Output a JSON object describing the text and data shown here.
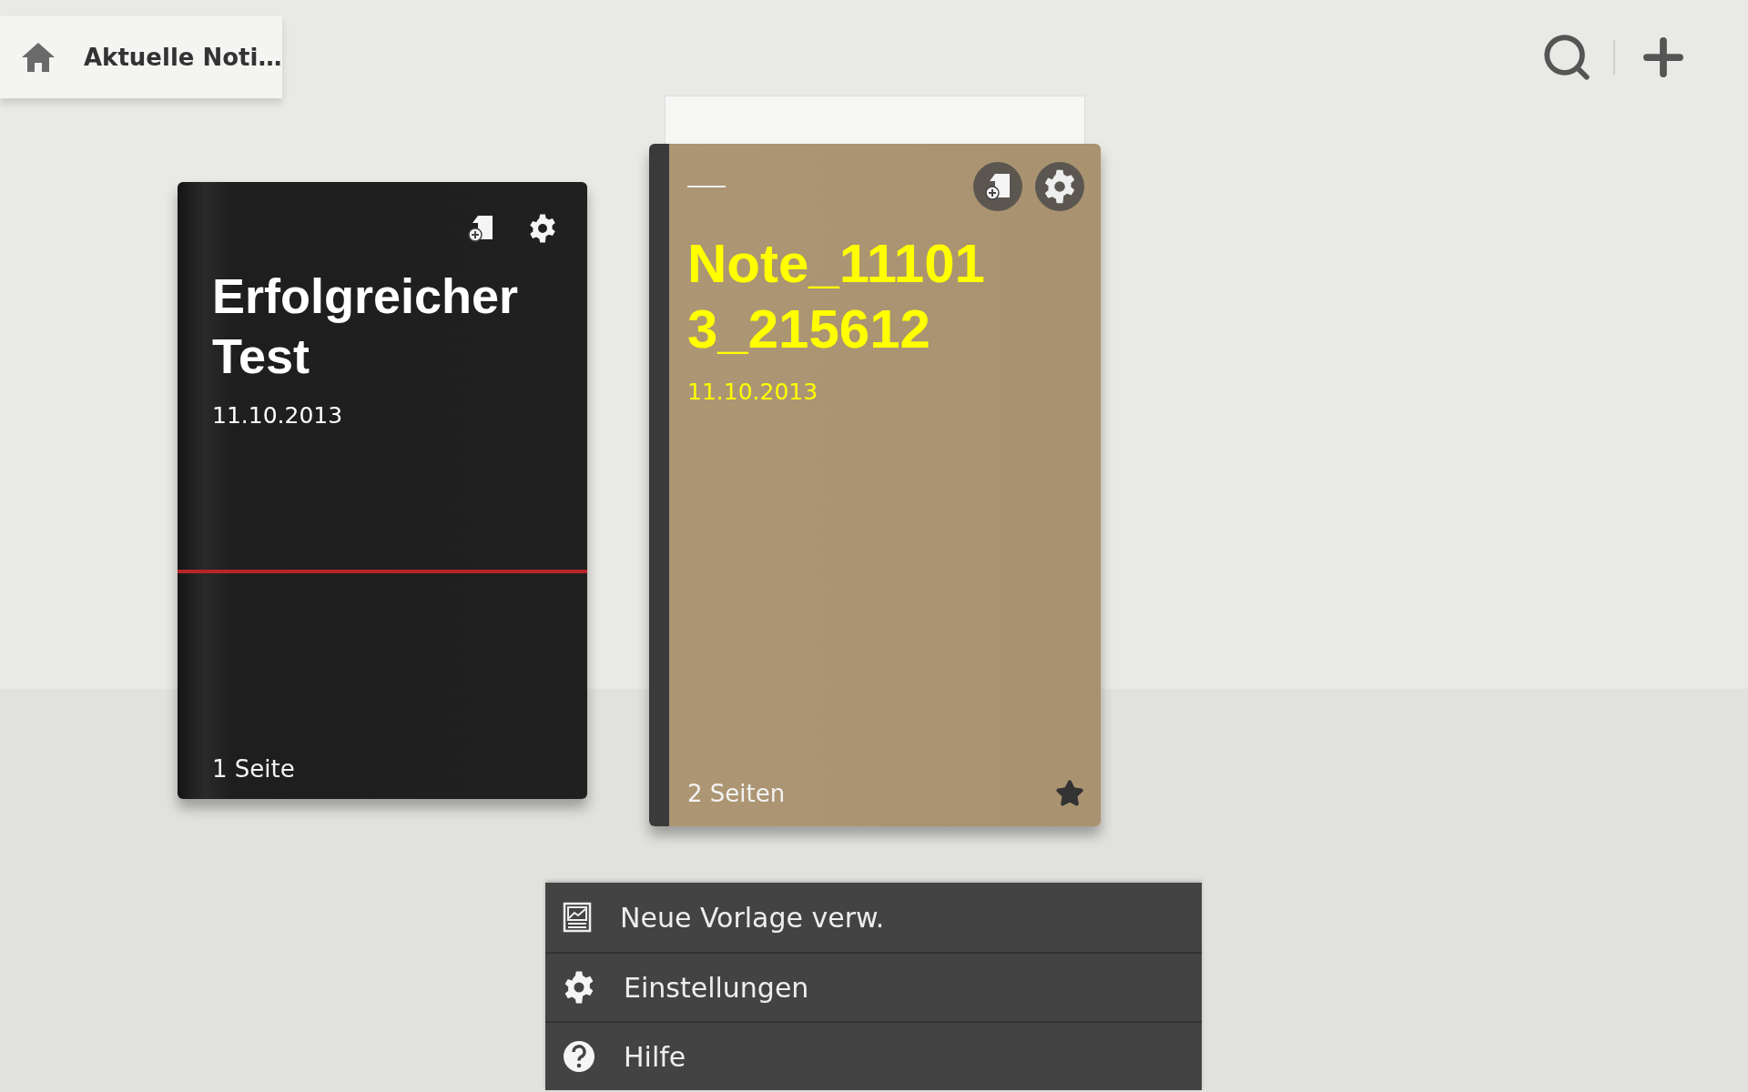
{
  "header": {
    "title": "Aktuelle Noti…"
  },
  "notebooks": [
    {
      "kind": "black",
      "title": "Erfolgreicher Test",
      "date": "11.10.2013",
      "pages": "1 Seite",
      "starred": false
    },
    {
      "kind": "kraft",
      "title": "Note_111013_215612",
      "date": "11.10.2013",
      "pages": "2 Seiten",
      "starred": true
    }
  ],
  "menu": [
    {
      "kind": "template",
      "label": "Neue Vorlage verw."
    },
    {
      "kind": "settings",
      "label": "Einstellungen"
    },
    {
      "kind": "help",
      "label": "Hilfe"
    }
  ]
}
